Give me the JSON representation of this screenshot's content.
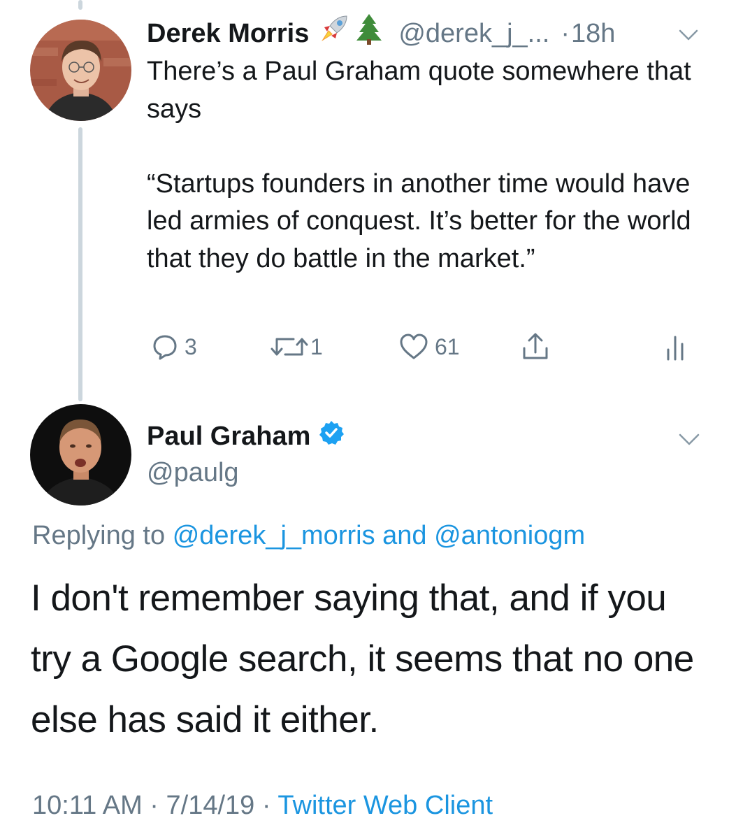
{
  "tweet1": {
    "display_name": "Derek Morris",
    "emojis": [
      "rocket-emoji",
      "evergreen-tree-emoji"
    ],
    "handle": "@derek_j_...",
    "separator": "·",
    "time": "18h",
    "body": "There’s a Paul Graham quote somewhere that says\n\n“Startups founders in another time would have led armies of conquest. It’s better for the world that they do battle in the market.”",
    "actions": {
      "reply_count": "3",
      "retweet_count": "1",
      "like_count": "61"
    },
    "icons": [
      "reply-icon",
      "retweet-icon",
      "like-icon",
      "share-icon",
      "analytics-icon",
      "chevron-down-icon"
    ]
  },
  "tweet2": {
    "display_name": "Paul Graham",
    "verified": true,
    "handle": "@paulg",
    "replying_prefix": "Replying to",
    "replying_user1": "@derek_j_morris",
    "replying_and": "and",
    "replying_user2": "@antoniogm",
    "body": "I don't remember saying that, and if you try a Google search, it seems that no one else has said it either.",
    "time": "10:11 AM",
    "sep1": "·",
    "date": "7/14/19",
    "sep2": "·",
    "client": "Twitter Web Client"
  },
  "colors": {
    "text": "#14171a",
    "secondary": "#657786",
    "link": "#1b95e0",
    "verified": "#1da1f2",
    "thread_line": "#ccd6dd"
  }
}
